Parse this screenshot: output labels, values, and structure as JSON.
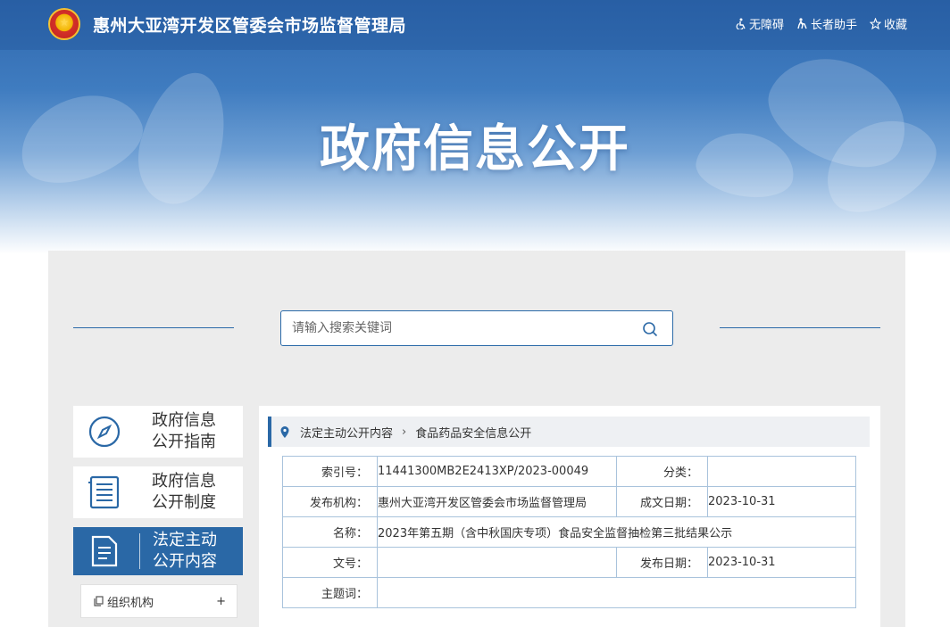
{
  "header": {
    "site_title": "惠州大亚湾开发区管委会市场监督管理局",
    "tools": [
      {
        "label": "无障碍",
        "icon": "accessibility-icon"
      },
      {
        "label": "长者助手",
        "icon": "elder-assist-icon"
      },
      {
        "label": "收藏",
        "icon": "star-icon"
      }
    ]
  },
  "hero": {
    "title": "政府信息公开"
  },
  "search": {
    "placeholder": "请输入搜索关键词",
    "value": ""
  },
  "sidebar": {
    "items": [
      {
        "label_line1": "政府信息",
        "label_line2": "公开指南",
        "icon": "compass-icon",
        "active": false
      },
      {
        "label_line1": "政府信息",
        "label_line2": "公开制度",
        "icon": "list-document-icon",
        "active": false
      },
      {
        "label_line1": "法定主动",
        "label_line2": "公开内容",
        "icon": "document-icon",
        "active": true
      }
    ],
    "sub_items": [
      {
        "label": "组织机构",
        "expand": "+"
      }
    ]
  },
  "breadcrumb": {
    "items": [
      "法定主动公开内容",
      "食品药品安全信息公开"
    ],
    "separator": "›"
  },
  "meta": {
    "index_label": "索引号：",
    "index_value": "11441300MB2E2413XP/2023-00049",
    "category_label": "分类：",
    "category_value": "",
    "publisher_label": "发布机构：",
    "publisher_value": "惠州大亚湾开发区管委会市场监督管理局",
    "created_label": "成文日期：",
    "created_value": "2023-10-31",
    "name_label": "名称：",
    "name_value": "2023年第五期（含中秋国庆专项）食品安全监督抽检第三批结果公示",
    "doc_no_label": "文号：",
    "doc_no_value": "",
    "published_label": "发布日期：",
    "published_value": "2023-10-31",
    "keywords_label": "主题词：",
    "keywords_value": ""
  },
  "colors": {
    "primary": "#2a68a6",
    "panel_bg": "#ececec",
    "table_border": "#a9c3dc"
  }
}
